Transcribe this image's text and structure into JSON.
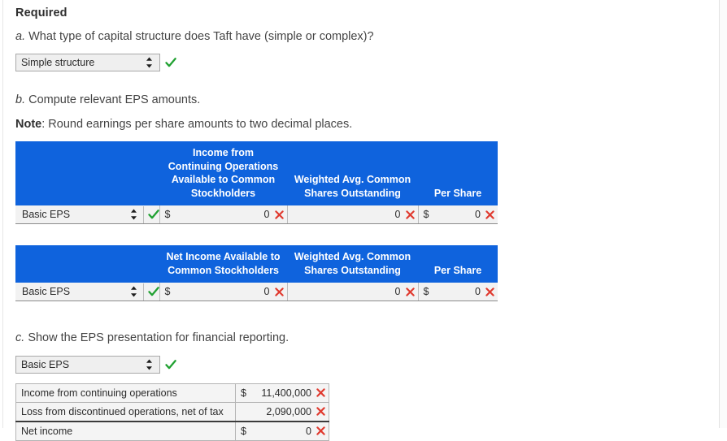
{
  "section": {
    "required_title": "Required",
    "question_a": {
      "marker": "a.",
      "text": "What type of capital structure does Taft have (simple or complex)?",
      "answer_value": "Simple structure",
      "status": "correct"
    },
    "question_b": {
      "marker": "b.",
      "text": "Compute relevant EPS amounts.",
      "note_label": "Note",
      "note_text": ": Round earnings per share amounts to two decimal places."
    },
    "question_c": {
      "marker": "c.",
      "text": "Show the EPS presentation for financial reporting.",
      "answer_value": "Basic EPS",
      "status": "correct"
    }
  },
  "table_continuing": {
    "headers": {
      "col0": "",
      "col1": "Income from Continuing Operations Available to Common Stockholders",
      "col2": "Weighted Avg. Common Shares Outstanding",
      "col3": "Per Share"
    },
    "row": {
      "label": "Basic EPS",
      "amount_currency": "$",
      "amount_value": "0",
      "shares_value": "0",
      "per_share_currency": "$",
      "per_share_value": "0"
    }
  },
  "table_netincome": {
    "headers": {
      "col0": "",
      "col1": "Net Income Available to Common Stockholders",
      "col2": "Weighted Avg. Common Shares Outstanding",
      "col3": "Per Share"
    },
    "row": {
      "label": "Basic EPS",
      "amount_currency": "$",
      "amount_value": "0",
      "shares_value": "0",
      "per_share_currency": "$",
      "per_share_value": "0"
    }
  },
  "table_presentation": {
    "rows": [
      {
        "label": "Income from continuing operations",
        "currency": "$",
        "value": "11,400,000",
        "status": "incorrect"
      },
      {
        "label": "Loss from discontinued operations, net of tax",
        "currency": "",
        "value": "2,090,000",
        "status": "incorrect"
      },
      {
        "label": "Net income",
        "currency": "$",
        "value": "0",
        "status": "incorrect"
      }
    ]
  },
  "icons": {
    "check": "check-icon",
    "cross": "cross-icon",
    "spinner": "updown-spinner-icon"
  },
  "colors": {
    "header_blue": "#0f63dd",
    "check_green": "#21a132",
    "cross_red": "#e03a2f",
    "cell_gray": "#f2f2f2"
  }
}
